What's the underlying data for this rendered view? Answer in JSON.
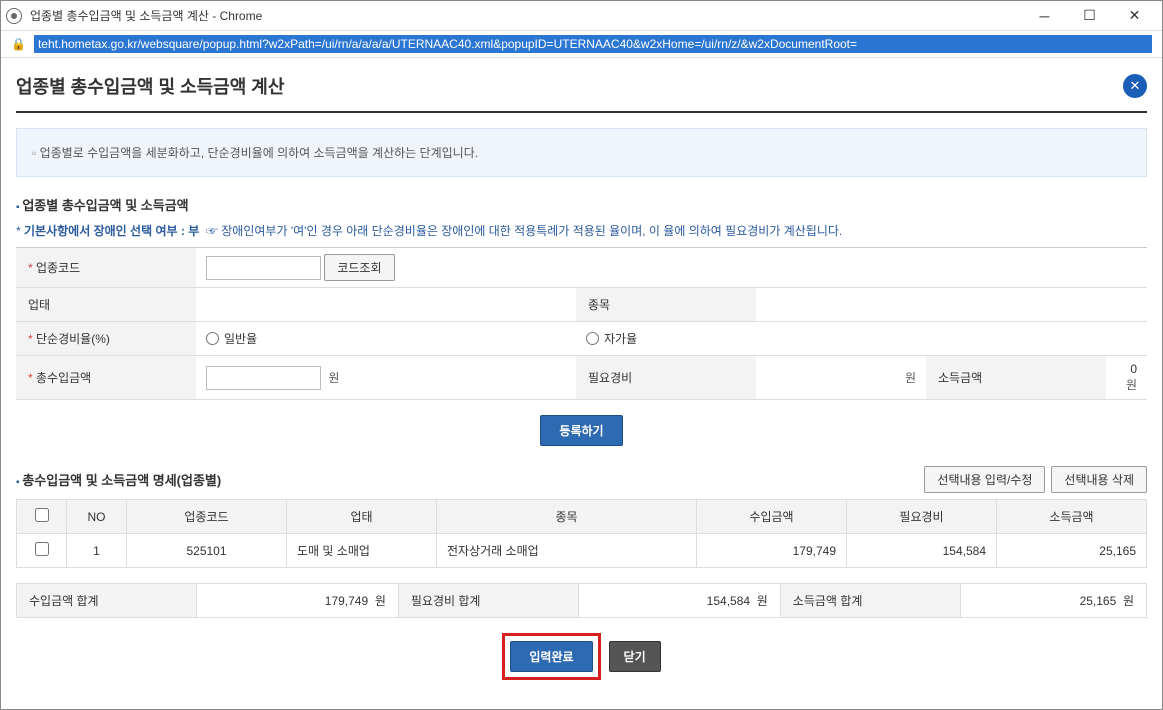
{
  "window": {
    "title": "업종별 총수입금액 및 소득금액 계산 - Chrome",
    "url": "teht.hometax.go.kr/websquare/popup.html?w2xPath=/ui/rn/a/a/a/a/UTERNAAC40.xml&popupID=UTERNAAC40&w2xHome=/ui/rn/z/&w2xDocumentRoot="
  },
  "page": {
    "title": "업종별 총수입금액 및 소득금액 계산"
  },
  "info_text": "업종별로 수입금액을 세분화하고, 단순경비율에 의하여 소득금액을 계산하는 단계입니다.",
  "section1": {
    "title": "업종별 총수입금액 및 소득금액",
    "note_prefix": "기본사항에서 장애인 선택 여부 :",
    "note_value": "부",
    "note_suffix": "☞ 장애인여부가 '여'인 경우 아래 단순경비율은 장애인에 대한 적용특례가 적용된 율이며, 이 율에 의하여 필요경비가 계산됩니다."
  },
  "form": {
    "labels": {
      "biz_code": "업종코드",
      "biz_type": "업태",
      "item": "종목",
      "simple_rate": "단순경비율(%)",
      "total_income": "총수입금액",
      "expense": "필요경비",
      "income_amount": "소득금액"
    },
    "code_btn": "코드조회",
    "rate_options": {
      "general": "일반율",
      "self": "자가율"
    },
    "won": "원",
    "income_value": "0",
    "register_btn": "등록하기"
  },
  "section2": {
    "title": "총수입금액 및 소득금액 명세(업종별)",
    "btn_edit": "선택내용 입력/수정",
    "btn_delete": "선택내용 삭제"
  },
  "table": {
    "headers": {
      "no": "NO",
      "code": "업종코드",
      "type": "업태",
      "item": "종목",
      "revenue": "수입금액",
      "expense": "필요경비",
      "income": "소득금액"
    },
    "rows": [
      {
        "no": "1",
        "code": "525101",
        "type": "도매 및 소매업",
        "item": "전자상거래 소매업",
        "revenue": "179,749",
        "expense": "154,584",
        "income": "25,165"
      }
    ]
  },
  "summary": {
    "revenue_label": "수입금액 합계",
    "revenue_value": "179,749",
    "expense_label": "필요경비 합계",
    "expense_value": "154,584",
    "income_label": "소득금액 합계",
    "income_value": "25,165",
    "won": "원"
  },
  "actions": {
    "submit": "입력완료",
    "close": "닫기"
  }
}
